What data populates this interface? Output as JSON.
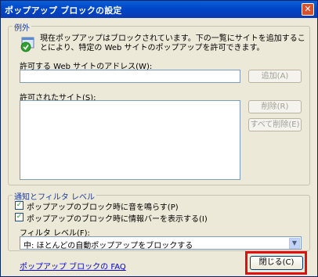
{
  "window": {
    "title": "ポップアップ ブロックの設定",
    "close_glyph": "✕"
  },
  "exceptions": {
    "group_label": "例外",
    "info_text": "現在ポップアップはブロックされています。下の一覧にサイトを追加することにより、特定の Web サイトのポップアップを許可できます。",
    "address_label": "許可する Web サイトのアドレス(W):",
    "address_value": "",
    "add_button": "追加(A)",
    "allowed_label": "許可されたサイト(S):",
    "allowed_sites": [],
    "remove_button": "削除(R)",
    "remove_all_button": "すべて削除(E)"
  },
  "notifications": {
    "group_label": "通知とフィルタ レベル",
    "play_sound_label": "ポップアップのブロック時に音を鳴らす(P)",
    "play_sound_checked": true,
    "show_infobar_label": "ポップアップのブロック時に情報バーを表示する(I)",
    "show_infobar_checked": true,
    "filter_level_label": "フィルタ レベル(F):",
    "filter_level_value": "中: ほとんどの自動ポップアップをブロックする"
  },
  "footer": {
    "faq_link": "ポップアップ ブロックの FAQ",
    "close_button": "閉じる(C)"
  },
  "icons": {
    "shield": "shield-check-icon",
    "close": "close-icon",
    "dropdown": "chevron-down-icon"
  },
  "colors": {
    "titlebar": "#0046c8",
    "highlight": "#e01010",
    "link": "#0000cc"
  }
}
